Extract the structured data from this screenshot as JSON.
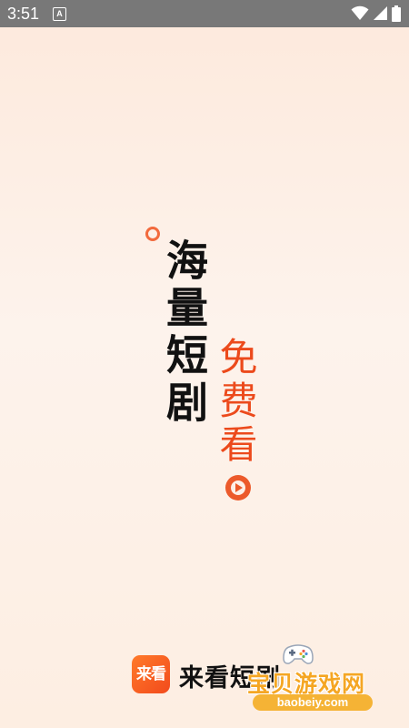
{
  "status_bar": {
    "time": "3:51",
    "notification_icon": "a-notification-icon",
    "wifi_icon": "wifi-icon",
    "signal_icon": "cell-signal-icon",
    "battery_icon": "battery-icon"
  },
  "hero": {
    "slogan_main": "海量短剧",
    "slogan_sub": "免费看",
    "accent_color": "#ec4a1c"
  },
  "brand": {
    "logo_text": "来看",
    "app_name": "来看短剧",
    "logo_color": "#f26a3d"
  },
  "watermark": {
    "text": "宝贝游戏网",
    "url": "baobeiy.com",
    "icon": "gamepad-icon"
  }
}
